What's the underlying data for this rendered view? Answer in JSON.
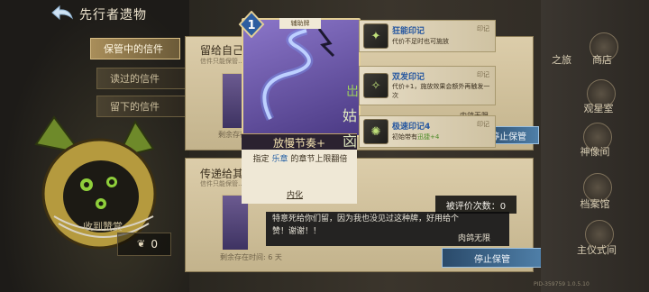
{
  "header": {
    "title": "先行者遗物"
  },
  "tabs": [
    {
      "label": "保管中的信件"
    },
    {
      "label": "读过的信件"
    },
    {
      "label": "留下的信件"
    }
  ],
  "letters": [
    {
      "title": "留给自己的…",
      "subtitle": "信件只能保管…",
      "remaining": "剩余存在…",
      "signer": "内鸽无限",
      "stop_label": "停止保管"
    },
    {
      "title": "传递给其他…",
      "subtitle": "信件只能保管…",
      "remaining": "剩余存在时间: 6 天",
      "comment": "特意死给你们留，因为我也没见过这种牌，好用给个赞！谢谢！！",
      "signer": "肉鸽无限",
      "stop_label": "停止保管",
      "evaluated": "被评价次数：0"
    }
  ],
  "left": {
    "received_label": "收到赞赏",
    "received_count": "0"
  },
  "card": {
    "level": "1",
    "tag": "辅助牌",
    "name": "放慢节奏+",
    "desc_prefix": "指定",
    "desc_highlight": "乐章",
    "desc_suffix": "的章节上限翻倍",
    "internalize": "内化"
  },
  "seals": [
    {
      "name": "狂能印记",
      "kind": "印记",
      "desc": "代价不足时也可施放",
      "glyph": "岀"
    },
    {
      "name": "双发印记",
      "kind": "印记",
      "desc": "代价+1，施放效果会额外再触发一次",
      "glyph": "姑"
    },
    {
      "name": "极速印记4",
      "kind": "印记",
      "desc_prefix": "初始带有",
      "desc_hl": "迅捷+4",
      "glyph": "㐫"
    }
  ],
  "right_menu": [
    {
      "label": "商店"
    },
    {
      "label": "之旅"
    },
    {
      "label": "观星室"
    },
    {
      "label": "神像间"
    },
    {
      "label": "档案馆"
    },
    {
      "label": "主仪式间"
    }
  ],
  "version": "PID-359759 1.0.5.10",
  "colors": {
    "accent_blue": "#2456a0",
    "highlight_green": "#4a8a25",
    "card_purple": "#6b58b0"
  }
}
